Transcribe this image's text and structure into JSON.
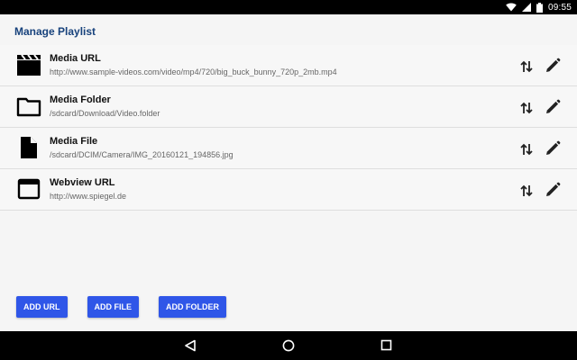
{
  "status": {
    "time": "09:55"
  },
  "app": {
    "title": "Manage Playlist"
  },
  "items": [
    {
      "name": "Media URL",
      "path": "http://www.sample-videos.com/video/mp4/720/big_buck_bunny_720p_2mb.mp4",
      "icon": "clapperboard-icon"
    },
    {
      "name": "Media Folder",
      "path": "/sdcard/Download/Video.folder",
      "icon": "folder-icon"
    },
    {
      "name": "Media File",
      "path": "/sdcard/DCIM/Camera/IMG_20160121_194856.jpg",
      "icon": "file-icon"
    },
    {
      "name": "Webview URL",
      "path": "http://www.spiegel.de",
      "icon": "browser-window-icon"
    }
  ],
  "actions": {
    "add_url": "ADD URL",
    "add_file": "ADD FILE",
    "add_folder": "ADD FOLDER"
  },
  "colors": {
    "accent": "#2f56e8",
    "title": "#17427c"
  }
}
